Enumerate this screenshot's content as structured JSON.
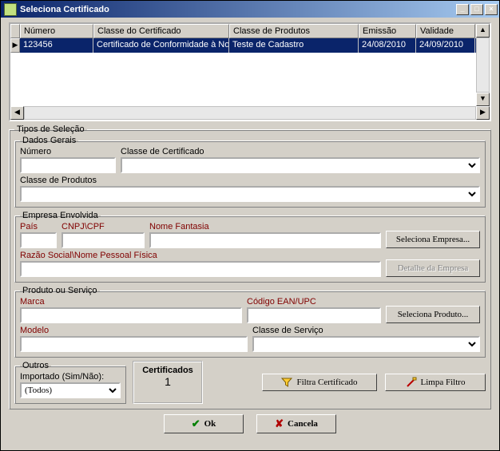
{
  "window": {
    "title": "Seleciona Certificado"
  },
  "grid": {
    "headers": {
      "numero": "Número",
      "classe_cert": "Classe do Certificado",
      "classe_prod": "Classe de Produtos",
      "emissao": "Emissão",
      "validade": "Validade"
    },
    "row": {
      "numero": "123456",
      "classe_cert": "Certificado de Conformidade à Norm",
      "classe_prod": "Teste de Cadastro",
      "emissao": "24/08/2010",
      "validade": "24/09/2010"
    }
  },
  "tipos_selecao": {
    "legend": "Tipos de Seleção",
    "dados_gerais": {
      "legend": "Dados Gerais",
      "numero_label": "Número",
      "classe_cert_label": "Classe de Certificado",
      "classe_prod_label": "Classe de Produtos"
    },
    "empresa": {
      "legend": "Empresa Envolvida",
      "pais_label": "País",
      "cnpj_label": "CNPJ\\CPF",
      "nome_fantasia_label": "Nome Fantasia",
      "razao_label": "Razão Social\\Nome Pessoal Física",
      "seleciona_btn": "Seleciona Empresa...",
      "detalhe_btn": "Detalhe da Empresa"
    },
    "produto": {
      "legend": "Produto ou Serviço",
      "marca_label": "Marca",
      "codigo_label": "Código EAN/UPC",
      "modelo_label": "Modelo",
      "classe_serv_label": "Classe de Serviço",
      "seleciona_btn": "Seleciona Produto..."
    },
    "outros": {
      "legend": "Outros",
      "importado_label": "Importado (Sim/Não):",
      "importado_value": "(Todos)"
    },
    "contador": {
      "label": "Certificados",
      "value": "1"
    },
    "filtra_btn": "Filtra Certificado",
    "limpa_btn": "Limpa Filtro"
  },
  "buttons": {
    "ok": "Ok",
    "cancel": "Cancela"
  }
}
